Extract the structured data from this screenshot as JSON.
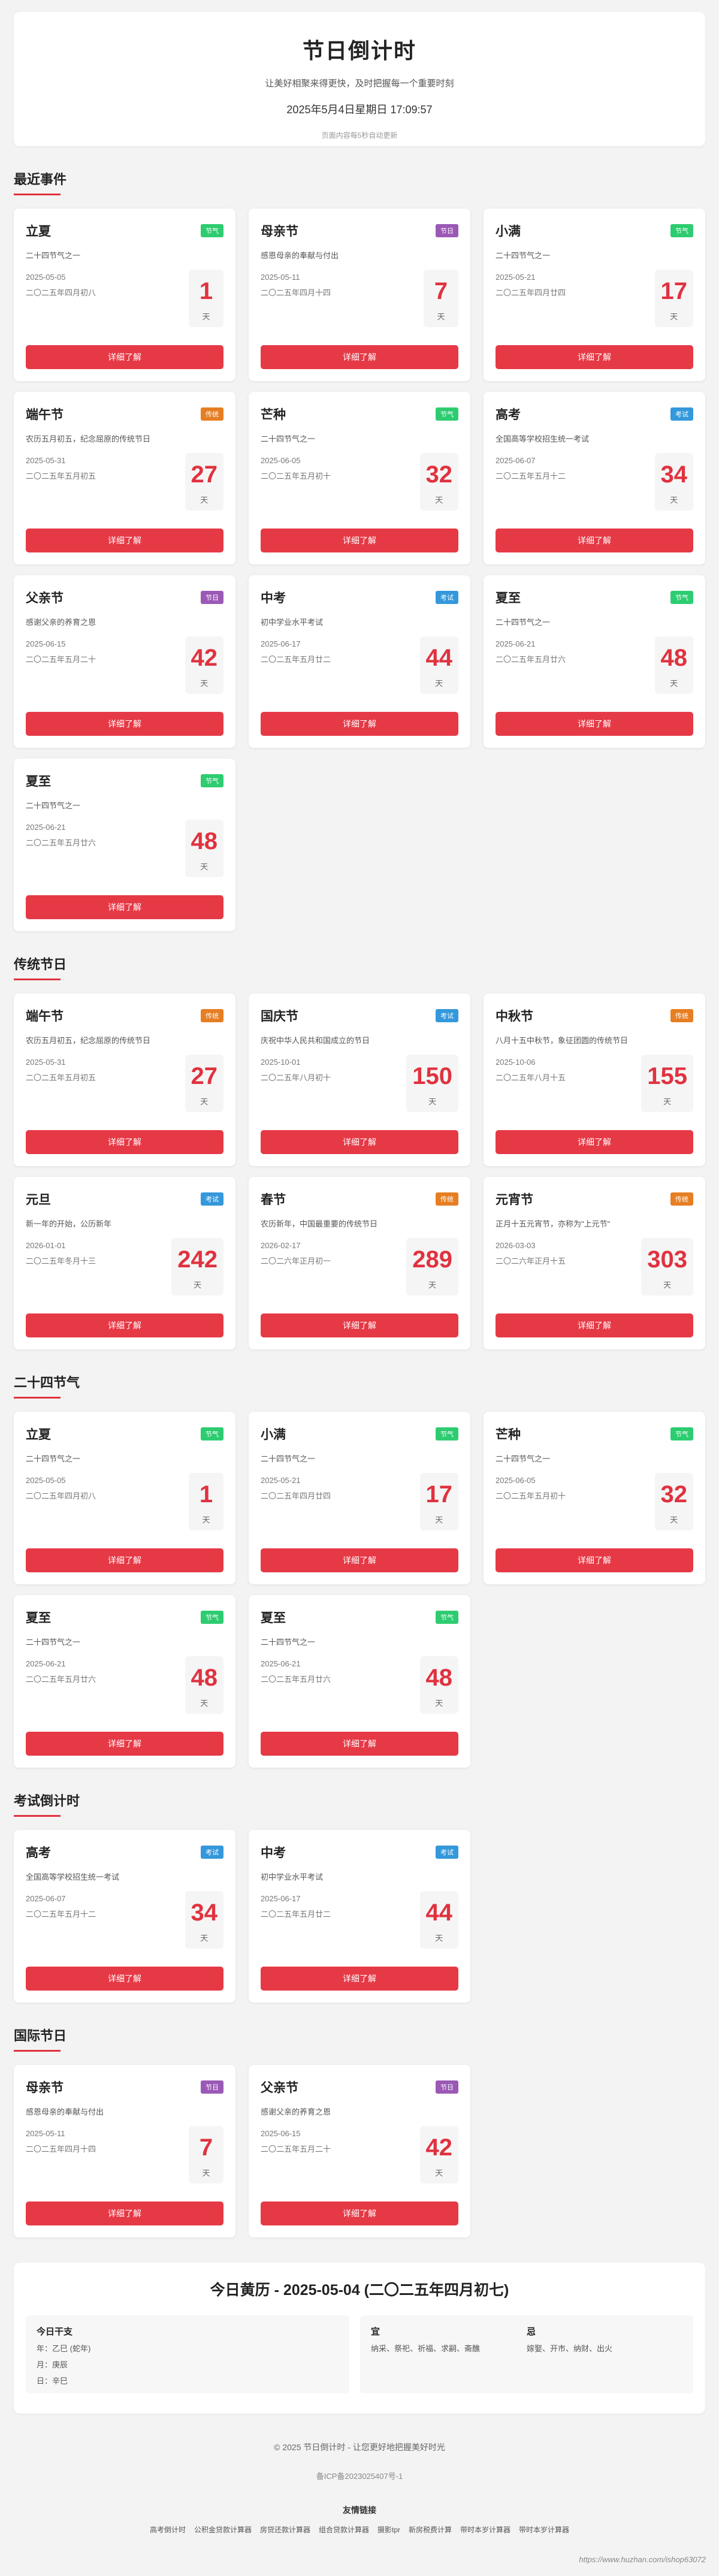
{
  "header": {
    "title": "节日倒计时",
    "subtitle": "让美好相聚来得更快，及时把握每一个重要时刻",
    "now": "2025年5月4日星期日 17:09:57",
    "note": "页面内容每5秒自动更新"
  },
  "sections": [
    {
      "title": "最近事件",
      "cards": [
        {
          "name": "立夏",
          "tag": "节气",
          "tag_type": "jieqi",
          "desc": "二十四节气之一",
          "date": "2025-05-05",
          "lunar": "二〇二五年四月初八",
          "days": "1",
          "unit": "天",
          "button": "详细了解"
        },
        {
          "name": "母亲节",
          "tag": "节日",
          "tag_type": "jieri",
          "desc": "感恩母亲的奉献与付出",
          "date": "2025-05-11",
          "lunar": "二〇二五年四月十四",
          "days": "7",
          "unit": "天",
          "button": "详细了解"
        },
        {
          "name": "小满",
          "tag": "节气",
          "tag_type": "jieqi",
          "desc": "二十四节气之一",
          "date": "2025-05-21",
          "lunar": "二〇二五年四月廿四",
          "days": "17",
          "unit": "天",
          "button": "详细了解"
        },
        {
          "name": "端午节",
          "tag": "传统",
          "tag_type": "chuantong",
          "desc": "农历五月初五，纪念屈原的传统节日",
          "date": "2025-05-31",
          "lunar": "二〇二五年五月初五",
          "days": "27",
          "unit": "天",
          "button": "详细了解"
        },
        {
          "name": "芒种",
          "tag": "节气",
          "tag_type": "jieqi",
          "desc": "二十四节气之一",
          "date": "2025-06-05",
          "lunar": "二〇二五年五月初十",
          "days": "32",
          "unit": "天",
          "button": "详细了解"
        },
        {
          "name": "高考",
          "tag": "考试",
          "tag_type": "kaoshi",
          "desc": "全国高等学校招生统一考试",
          "date": "2025-06-07",
          "lunar": "二〇二五年五月十二",
          "days": "34",
          "unit": "天",
          "button": "详细了解"
        },
        {
          "name": "父亲节",
          "tag": "节日",
          "tag_type": "jieri",
          "desc": "感谢父亲的养育之恩",
          "date": "2025-06-15",
          "lunar": "二〇二五年五月二十",
          "days": "42",
          "unit": "天",
          "button": "详细了解"
        },
        {
          "name": "中考",
          "tag": "考试",
          "tag_type": "kaoshi",
          "desc": "初中学业水平考试",
          "date": "2025-06-17",
          "lunar": "二〇二五年五月廿二",
          "days": "44",
          "unit": "天",
          "button": "详细了解"
        },
        {
          "name": "夏至",
          "tag": "节气",
          "tag_type": "jieqi",
          "desc": "二十四节气之一",
          "date": "2025-06-21",
          "lunar": "二〇二五年五月廿六",
          "days": "48",
          "unit": "天",
          "button": "详细了解"
        },
        {
          "name": "夏至",
          "tag": "节气",
          "tag_type": "jieqi",
          "desc": "二十四节气之一",
          "date": "2025-06-21",
          "lunar": "二〇二五年五月廿六",
          "days": "48",
          "unit": "天",
          "button": "详细了解"
        }
      ]
    },
    {
      "title": "传统节日",
      "cards": [
        {
          "name": "端午节",
          "tag": "传统",
          "tag_type": "chuantong",
          "desc": "农历五月初五，纪念屈原的传统节日",
          "date": "2025-05-31",
          "lunar": "二〇二五年五月初五",
          "days": "27",
          "unit": "天",
          "button": "详细了解"
        },
        {
          "name": "国庆节",
          "tag": "考试",
          "tag_type": "kaoshi",
          "desc": "庆祝中华人民共和国成立的节日",
          "date": "2025-10-01",
          "lunar": "二〇二五年八月初十",
          "days": "150",
          "unit": "天",
          "button": "详细了解"
        },
        {
          "name": "中秋节",
          "tag": "传统",
          "tag_type": "chuantong",
          "desc": "八月十五中秋节，象征团圆的传统节日",
          "date": "2025-10-06",
          "lunar": "二〇二五年八月十五",
          "days": "155",
          "unit": "天",
          "button": "详细了解"
        },
        {
          "name": "元旦",
          "tag": "考试",
          "tag_type": "kaoshi",
          "desc": "新一年的开始，公历新年",
          "date": "2026-01-01",
          "lunar": "二〇二五年冬月十三",
          "days": "242",
          "unit": "天",
          "button": "详细了解"
        },
        {
          "name": "春节",
          "tag": "传统",
          "tag_type": "chuantong",
          "desc": "农历新年，中国最重要的传统节日",
          "date": "2026-02-17",
          "lunar": "二〇二六年正月初一",
          "days": "289",
          "unit": "天",
          "button": "详细了解"
        },
        {
          "name": "元宵节",
          "tag": "传统",
          "tag_type": "chuantong",
          "desc": "正月十五元宵节，亦称为\"上元节\"",
          "date": "2026-03-03",
          "lunar": "二〇二六年正月十五",
          "days": "303",
          "unit": "天",
          "button": "详细了解"
        }
      ]
    },
    {
      "title": "二十四节气",
      "cards": [
        {
          "name": "立夏",
          "tag": "节气",
          "tag_type": "jieqi",
          "desc": "二十四节气之一",
          "date": "2025-05-05",
          "lunar": "二〇二五年四月初八",
          "days": "1",
          "unit": "天",
          "button": "详细了解"
        },
        {
          "name": "小满",
          "tag": "节气",
          "tag_type": "jieqi",
          "desc": "二十四节气之一",
          "date": "2025-05-21",
          "lunar": "二〇二五年四月廿四",
          "days": "17",
          "unit": "天",
          "button": "详细了解"
        },
        {
          "name": "芒种",
          "tag": "节气",
          "tag_type": "jieqi",
          "desc": "二十四节气之一",
          "date": "2025-06-05",
          "lunar": "二〇二五年五月初十",
          "days": "32",
          "unit": "天",
          "button": "详细了解"
        },
        {
          "name": "夏至",
          "tag": "节气",
          "tag_type": "jieqi",
          "desc": "二十四节气之一",
          "date": "2025-06-21",
          "lunar": "二〇二五年五月廿六",
          "days": "48",
          "unit": "天",
          "button": "详细了解"
        },
        {
          "name": "夏至",
          "tag": "节气",
          "tag_type": "jieqi",
          "desc": "二十四节气之一",
          "date": "2025-06-21",
          "lunar": "二〇二五年五月廿六",
          "days": "48",
          "unit": "天",
          "button": "详细了解"
        }
      ]
    },
    {
      "title": "考试倒计时",
      "cards": [
        {
          "name": "高考",
          "tag": "考试",
          "tag_type": "kaoshi",
          "desc": "全国高等学校招生统一考试",
          "date": "2025-06-07",
          "lunar": "二〇二五年五月十二",
          "days": "34",
          "unit": "天",
          "button": "详细了解"
        },
        {
          "name": "中考",
          "tag": "考试",
          "tag_type": "kaoshi",
          "desc": "初中学业水平考试",
          "date": "2025-06-17",
          "lunar": "二〇二五年五月廿二",
          "days": "44",
          "unit": "天",
          "button": "详细了解"
        }
      ]
    },
    {
      "title": "国际节日",
      "cards": [
        {
          "name": "母亲节",
          "tag": "节日",
          "tag_type": "jieri",
          "desc": "感恩母亲的奉献与付出",
          "date": "2025-05-11",
          "lunar": "二〇二五年四月十四",
          "days": "7",
          "unit": "天",
          "button": "详细了解"
        },
        {
          "name": "父亲节",
          "tag": "节日",
          "tag_type": "jieri",
          "desc": "感谢父亲的养育之恩",
          "date": "2025-06-15",
          "lunar": "二〇二五年五月二十",
          "days": "42",
          "unit": "天",
          "button": "详细了解"
        }
      ]
    }
  ],
  "almanac": {
    "title": "今日黄历 - 2025-05-04 (二〇二五年四月初七)",
    "today_heading": "今日干支",
    "year": "年：乙巳 (蛇年)",
    "month": "月：庚辰",
    "day": "日：辛巳",
    "yi_heading": "宜",
    "yi": "纳采、祭祀、祈福、求嗣、斋醮",
    "ji_heading": "忌",
    "ji": "嫁娶、开市、纳财、出火"
  },
  "footer": {
    "copyright": "© 2025 节日倒计时 - 让您更好地把握美好时光",
    "icp": "备ICP备2023025407号-1",
    "links_title": "友情链接",
    "links": [
      "高考倒计时",
      "公积金贷款计算器",
      "房贷还款计算器",
      "组合贷款计算器",
      "摄影tpr",
      "新房税费计算",
      "带时本岁计算器",
      "带时本岁计算器"
    ],
    "watermark": "https://www.huzhan.com/ishop63072"
  },
  "colors": {
    "accent": "#e63946",
    "count": "#e0323f",
    "jieqi": "#2ecc71",
    "jieri": "#9b59b6",
    "chuantong": "#e67e22",
    "kaoshi": "#3498db"
  }
}
